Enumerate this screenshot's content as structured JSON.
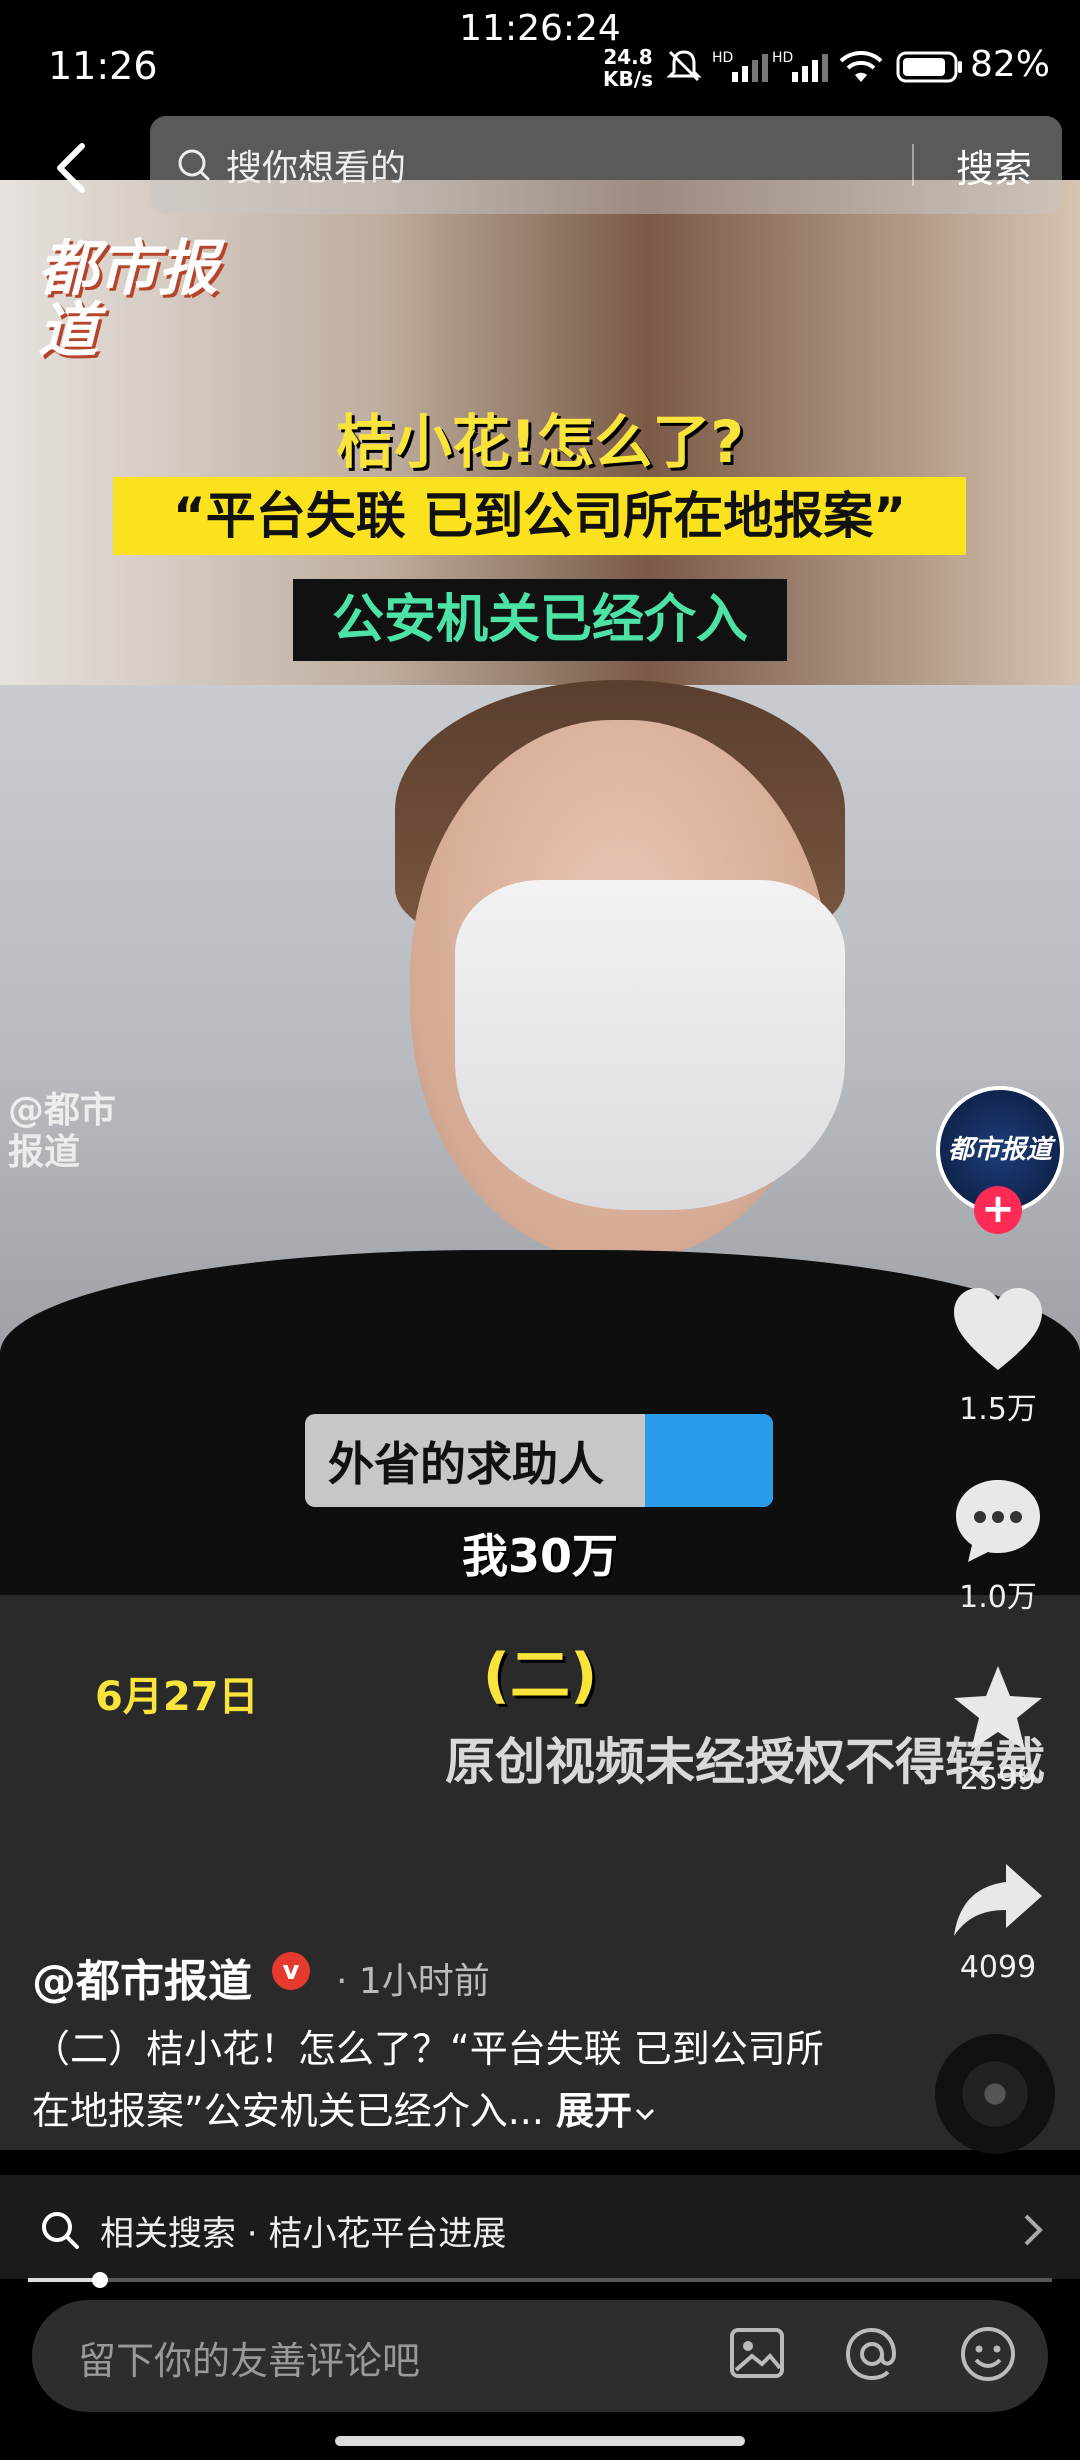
{
  "status": {
    "clock_center": "11:26:24",
    "clock_left": "11:26",
    "net_speed_value": "24.8",
    "net_speed_unit": "KB/s",
    "battery": "82%"
  },
  "search": {
    "placeholder": "搜你想看的",
    "button": "搜索"
  },
  "video": {
    "logo": "都市报道",
    "headline": "桔小花!怎么了?",
    "headline_yellow": "“平台失联  已到公司所在地报案”",
    "headline_dark": "公安机关已经介入",
    "side_watermark_line1": "@都市",
    "side_watermark_line2": "报道",
    "caption_label": "外省的求助人",
    "subtitle": "我30万",
    "part_label": "(二)",
    "date": "6月27日",
    "copyright": "原创视频未经授权不得转载"
  },
  "actions": {
    "avatar_text": "都市报道",
    "follow_plus": "+",
    "likes": "1.5万",
    "comments": "1.0万",
    "favorites": "2599",
    "shares": "4099"
  },
  "post": {
    "author": "@都市报道",
    "verified_mark": "v",
    "time_ago": "· 1小时前",
    "description": "（二）桔小花！怎么了？“平台失联 已到公司所在地报案”公安机关已经介入...",
    "expand_label": "展开"
  },
  "related": {
    "text": "相关搜索 · 桔小花平台进展"
  },
  "playback": {
    "progress_fraction": 0.07
  },
  "comment": {
    "placeholder": "留下你的友善评论吧"
  }
}
